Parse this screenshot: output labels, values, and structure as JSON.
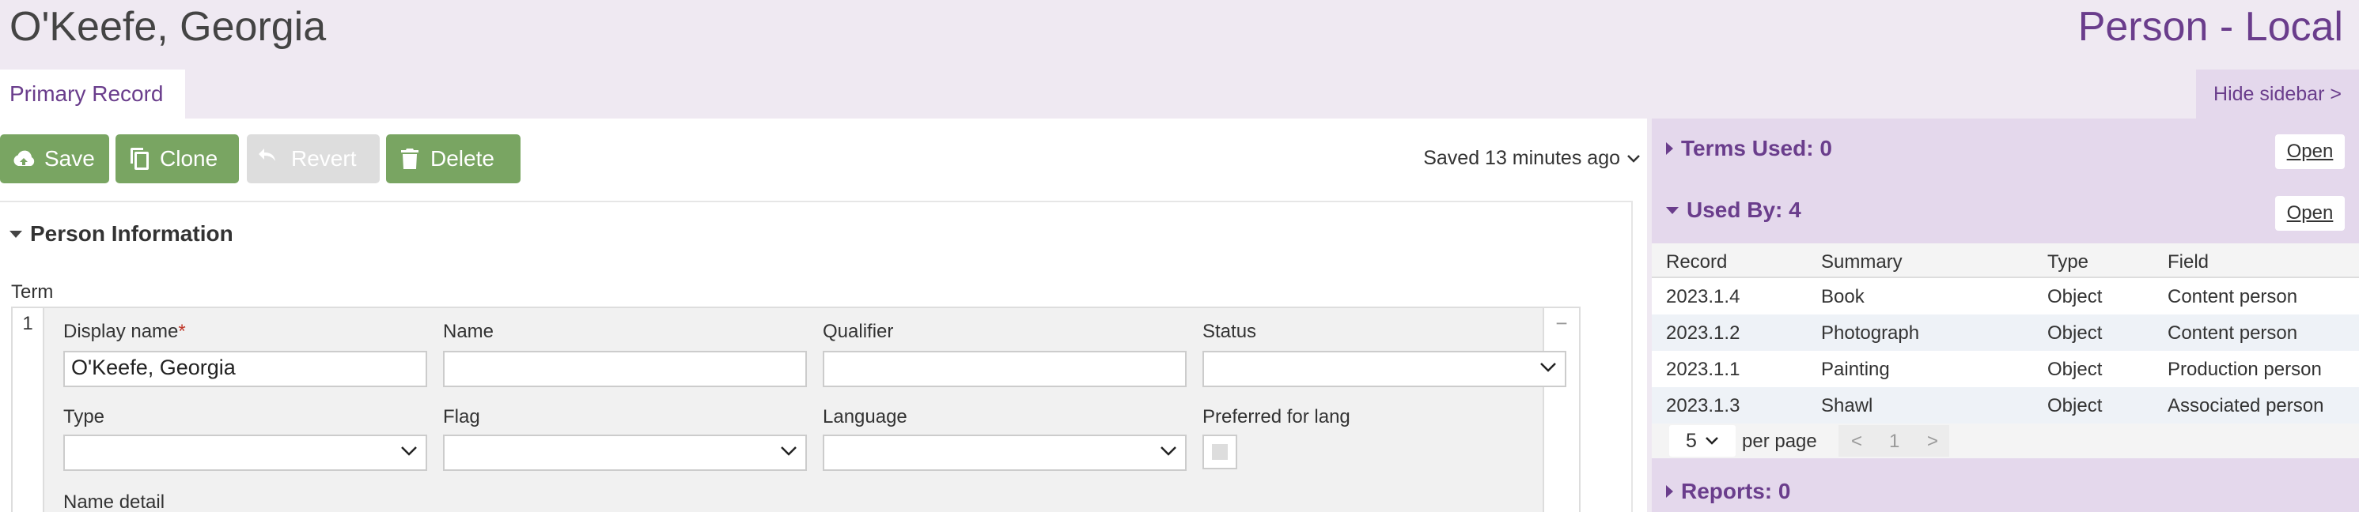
{
  "header": {
    "record_title": "O'Keefe, Georgia",
    "record_type": "Person - Local"
  },
  "tabs": {
    "primary": "Primary Record",
    "hide_sidebar": "Hide sidebar >"
  },
  "toolbar": {
    "save": "Save",
    "clone": "Clone",
    "revert": "Revert",
    "delete": "Delete",
    "saved_status": "Saved 13 minutes ago"
  },
  "section": {
    "title": "Person Information",
    "term_label": "Term",
    "row_number": "1",
    "remove_symbol": "−",
    "fields": {
      "display_name_label": "Display name",
      "display_name_required": "*",
      "display_name_value": "O'Keefe, Georgia",
      "name_label": "Name",
      "qualifier_label": "Qualifier",
      "status_label": "Status",
      "type_label": "Type",
      "flag_label": "Flag",
      "language_label": "Language",
      "preferred_label": "Preferred for lang",
      "name_detail_label": "Name detail"
    }
  },
  "sidebar": {
    "terms_used": {
      "title": "Terms Used: 0",
      "open": "Open"
    },
    "used_by": {
      "title": "Used By: 4",
      "open": "Open",
      "columns": [
        "Record",
        "Summary",
        "Type",
        "Field"
      ],
      "rows": [
        [
          "2023.1.4",
          "Book",
          "Object",
          "Content person"
        ],
        [
          "2023.1.2",
          "Photograph",
          "Object",
          "Content person"
        ],
        [
          "2023.1.1",
          "Painting",
          "Object",
          "Production person"
        ],
        [
          "2023.1.3",
          "Shawl",
          "Object",
          "Associated person"
        ]
      ],
      "pager": {
        "page_size": "5",
        "per_page": "per page",
        "prev": "<",
        "page": "1",
        "next": ">"
      }
    },
    "reports": {
      "title": "Reports: 0"
    }
  },
  "colors": {
    "accent": "#6a3d8c",
    "button_green": "#79a562",
    "sidebar_bg": "#e4d8ec",
    "header_bg": "#efe9f2"
  }
}
